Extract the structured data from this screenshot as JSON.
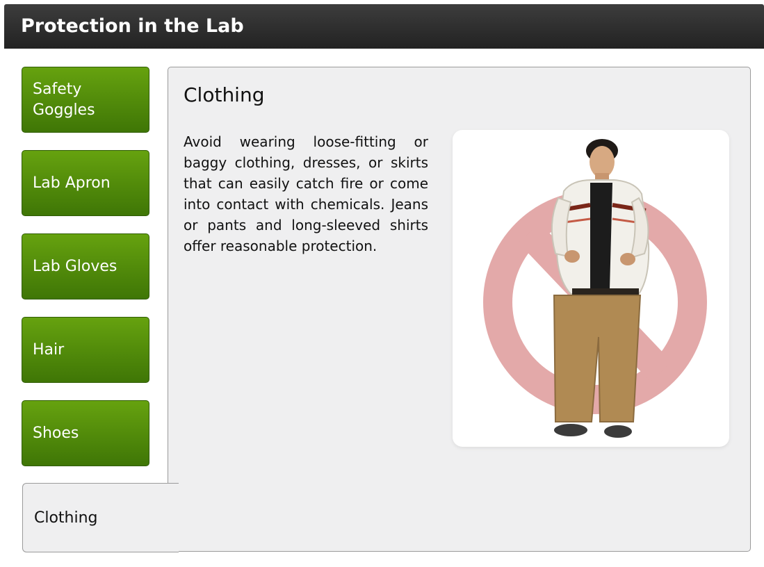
{
  "window": {
    "title": "Protection in the Lab"
  },
  "tabs": [
    {
      "label": "Safety Goggles",
      "active": false
    },
    {
      "label": "Lab Apron",
      "active": false
    },
    {
      "label": "Lab Gloves",
      "active": false
    },
    {
      "label": "Hair",
      "active": false
    },
    {
      "label": "Shoes",
      "active": false
    },
    {
      "label": "Clothing",
      "active": true
    }
  ],
  "content": {
    "heading": "Clothing",
    "body": "Avoid wearing loose-fitting or baggy clothing, dresses, or skirts that can easily catch fire or come into contact with chemicals. Jeans or pants and long-sleeved shirts offer reasonable protection.",
    "image": {
      "subject": "person-in-baggy-clothing",
      "overlay_icon": "prohibited-icon",
      "overlay_color": "#e3a9a9"
    }
  },
  "colors": {
    "tab_green_top": "#66a20f",
    "tab_green_bottom": "#3f7606",
    "titlebar": "#2c2c2c",
    "panel": "#efeff0"
  }
}
